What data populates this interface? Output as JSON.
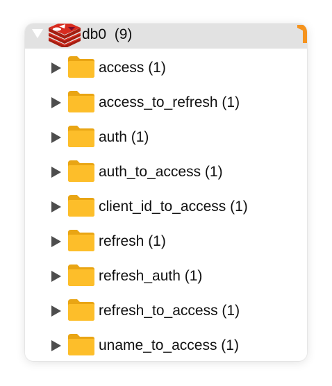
{
  "database": {
    "name": "db0",
    "count": "(9)",
    "icon": "redis-logo-icon",
    "colors": {
      "logo": "#d82c20",
      "corner": "#f5931e"
    }
  },
  "folder_color": "#fdbe2a",
  "keys": [
    {
      "label": "access (1)"
    },
    {
      "label": "access_to_refresh (1)"
    },
    {
      "label": "auth (1)"
    },
    {
      "label": "auth_to_access (1)"
    },
    {
      "label": "client_id_to_access (1)"
    },
    {
      "label": "refresh (1)"
    },
    {
      "label": "refresh_auth (1)"
    },
    {
      "label": "refresh_to_access (1)"
    },
    {
      "label": "uname_to_access (1)"
    }
  ]
}
